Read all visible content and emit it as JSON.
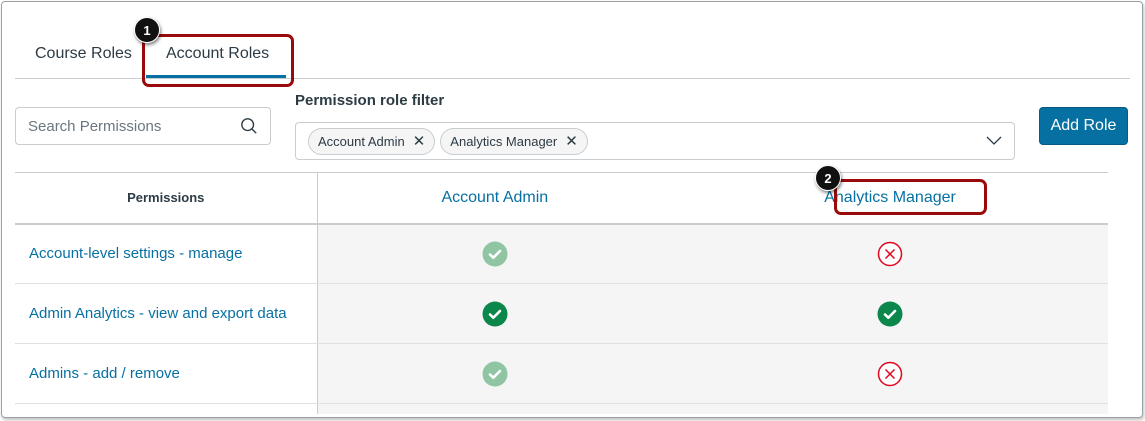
{
  "tabs": [
    {
      "label": "Course Roles",
      "active": false
    },
    {
      "label": "Account Roles",
      "active": true
    }
  ],
  "callouts": [
    "1",
    "2"
  ],
  "search": {
    "placeholder": "Search Permissions",
    "value": ""
  },
  "filter": {
    "label": "Permission role filter",
    "chips": [
      "Account Admin",
      "Analytics Manager"
    ]
  },
  "add_role_label": "Add Role",
  "table": {
    "header": "Permissions",
    "roles": [
      "Account Admin",
      "Analytics Manager"
    ],
    "rows": [
      {
        "name": "Account-level settings - manage",
        "values": [
          "enabled-locked",
          "disabled"
        ]
      },
      {
        "name": "Admin Analytics - view and export data",
        "values": [
          "enabled",
          "enabled"
        ]
      },
      {
        "name": "Admins - add / remove",
        "values": [
          "enabled-locked",
          "disabled"
        ]
      }
    ]
  },
  "colors": {
    "accent": "#0770a3",
    "enabled": "#0b874b",
    "enabled_locked": "#8fc5a2",
    "disabled": "#e0061f",
    "callout": "#9b0a0a"
  }
}
